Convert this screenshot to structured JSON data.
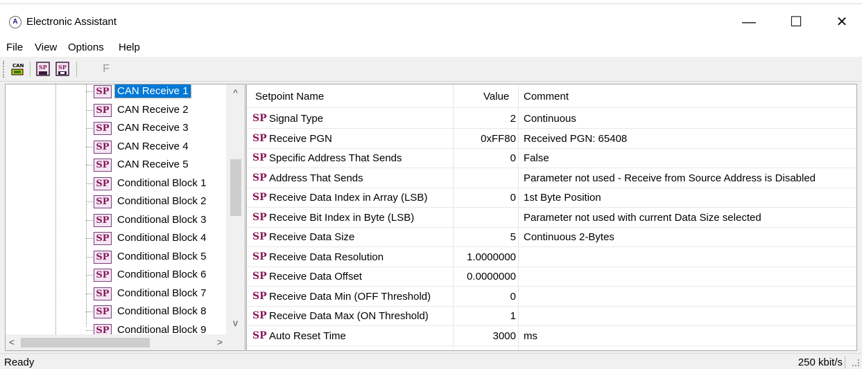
{
  "window": {
    "title": "Electronic Assistant",
    "minimize_glyph": "—",
    "maximize_glyph": "☐",
    "close_glyph": "✕"
  },
  "menu": [
    "File",
    "View",
    "Options",
    "Help"
  ],
  "toolbar": {
    "buttons": [
      {
        "icon": "can-connect-icon",
        "text": "CAN"
      },
      {
        "icon": "setpoint-read-icon",
        "text": "SP"
      },
      {
        "icon": "setpoint-write-icon",
        "text": "SP"
      },
      {
        "icon": "flash-icon",
        "text": "F"
      }
    ]
  },
  "tree": {
    "items": [
      "CAN Receive 1",
      "CAN Receive 2",
      "CAN Receive 3",
      "CAN Receive 4",
      "CAN Receive 5",
      "Conditional Block 1",
      "Conditional Block 2",
      "Conditional Block 3",
      "Conditional Block 4",
      "Conditional Block 5",
      "Conditional Block 6",
      "Conditional Block 7",
      "Conditional Block 8",
      "Conditional Block 9"
    ],
    "selected_index": 0,
    "node_badge": "SP"
  },
  "table": {
    "headers": {
      "name": "Setpoint Name",
      "value": "Value",
      "comment": "Comment"
    },
    "badge": "SP",
    "rows": [
      {
        "name": "Signal Type",
        "value": "2",
        "comment": "Continuous"
      },
      {
        "name": "Receive PGN",
        "value": "0xFF80",
        "comment": "Received PGN: 65408"
      },
      {
        "name": "Specific Address That Sends",
        "value": "0",
        "comment": "False"
      },
      {
        "name": "Address That Sends",
        "value": "",
        "comment": "Parameter not used - Receive from Source Address is Disabled"
      },
      {
        "name": "Receive Data Index in Array (LSB)",
        "value": "0",
        "comment": "1st Byte Position"
      },
      {
        "name": "Receive Bit Index in Byte (LSB)",
        "value": "",
        "comment": "Parameter not used with current Data Size selected"
      },
      {
        "name": "Receive Data Size",
        "value": "5",
        "comment": "Continuous 2-Bytes"
      },
      {
        "name": "Receive Data Resolution",
        "value": "1.0000000",
        "comment": ""
      },
      {
        "name": "Receive Data Offset",
        "value": "0.0000000",
        "comment": ""
      },
      {
        "name": "Receive Data Min (OFF Threshold)",
        "value": "0",
        "comment": ""
      },
      {
        "name": "Receive Data Max (ON Threshold)",
        "value": "1",
        "comment": ""
      },
      {
        "name": "Auto Reset Time",
        "value": "3000",
        "comment": "ms"
      }
    ]
  },
  "status": {
    "left": "Ready",
    "right": "250 kbit/s"
  },
  "colors": {
    "selection": "#0078d7",
    "sp_badge": "#8a1a5a"
  }
}
